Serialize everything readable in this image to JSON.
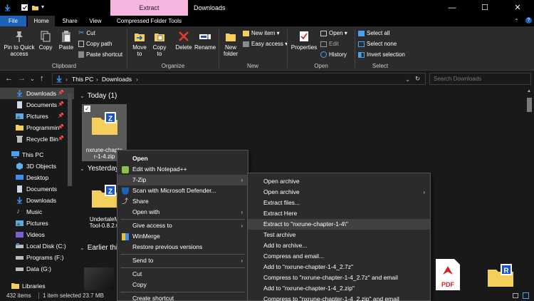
{
  "window": {
    "context_tab": "Extract",
    "title": "Downloads",
    "minimize": "—",
    "maximize": "☐",
    "close": "✕"
  },
  "ribbon_tabs": [
    "File",
    "Home",
    "Share",
    "View",
    "Compressed Folder Tools"
  ],
  "ribbon": {
    "clipboard": {
      "group": "Clipboard",
      "pin": "Pin to Quick access",
      "copy": "Copy",
      "paste": "Paste",
      "cut": "Cut",
      "copy_path": "Copy path",
      "paste_shortcut": "Paste shortcut"
    },
    "organize": {
      "group": "Organize",
      "move_to": "Move to",
      "copy_to": "Copy to",
      "delete": "Delete",
      "rename": "Rename"
    },
    "new": {
      "group": "New",
      "new_folder": "New folder",
      "new_item": "New item ▾",
      "easy_access": "Easy access ▾"
    },
    "open": {
      "group": "Open",
      "properties": "Properties",
      "open": "Open ▾",
      "edit": "Edit",
      "history": "History"
    },
    "select": {
      "group": "Select",
      "select_all": "Select all",
      "select_none": "Select none",
      "invert": "Invert selection"
    }
  },
  "address": {
    "crumbs": [
      "This PC",
      "Downloads"
    ],
    "search_placeholder": "Search Downloads"
  },
  "sidebar": {
    "items": [
      {
        "label": "Downloads",
        "pin": "📌"
      },
      {
        "label": "Documents",
        "pin": "📌"
      },
      {
        "label": "Pictures",
        "pin": "📌"
      },
      {
        "label": "Programmin",
        "pin": "📌"
      },
      {
        "label": "Recycle Bin",
        "pin": "📌"
      },
      {
        "label": "This PC",
        "pin": ""
      },
      {
        "label": "3D Objects",
        "pin": ""
      },
      {
        "label": "Desktop",
        "pin": ""
      },
      {
        "label": "Documents",
        "pin": ""
      },
      {
        "label": "Downloads",
        "pin": ""
      },
      {
        "label": "Music",
        "pin": ""
      },
      {
        "label": "Pictures",
        "pin": ""
      },
      {
        "label": "Videos",
        "pin": ""
      },
      {
        "label": "Local Disk (C:)",
        "pin": ""
      },
      {
        "label": "Programs (F:)",
        "pin": ""
      },
      {
        "label": "Data (G:)",
        "pin": ""
      },
      {
        "label": "Libraries",
        "pin": ""
      }
    ]
  },
  "content": {
    "groups": [
      "Today (1)",
      "Yesterday",
      "Earlier thi"
    ],
    "files": {
      "selected_line1": "nxrune-chapte",
      "selected_line2": "r-1-4.zip",
      "yesterday_line1": "UndertaleM",
      "yesterday_line2": "Tool-0.8.2.0"
    },
    "icon_letters": {
      "zip": "Z",
      "rar": "R",
      "pdf": "PDF"
    }
  },
  "status": {
    "items": "432 items",
    "selected": "1 item selected  23.7 MB"
  },
  "context_menu": [
    {
      "label": "Open",
      "bold": true
    },
    {
      "label": "Edit with Notepad++"
    },
    {
      "label": "7-Zip",
      "submenu": true
    },
    {
      "label": "Scan with Microsoft Defender..."
    },
    {
      "label": "Share"
    },
    {
      "label": "Open with",
      "submenu": true
    },
    {
      "label": "Give access to",
      "submenu": true
    },
    {
      "label": "WinMerge"
    },
    {
      "label": "Restore previous versions"
    },
    {
      "label": "Send to",
      "submenu": true
    },
    {
      "label": "Cut"
    },
    {
      "label": "Copy"
    },
    {
      "label": "Create shortcut"
    }
  ],
  "zip_submenu": [
    {
      "label": "Open archive"
    },
    {
      "label": "Open archive",
      "submenu": true
    },
    {
      "label": "Extract files..."
    },
    {
      "label": "Extract Here"
    },
    {
      "label": "Extract to \"nxrune-chapter-1-4\\\""
    },
    {
      "label": "Test archive"
    },
    {
      "label": "Add to archive..."
    },
    {
      "label": "Compress and email..."
    },
    {
      "label": "Add to \"nxrune-chapter-1-4_2.7z\""
    },
    {
      "label": "Compress to \"nxrune-chapter-1-4_2.7z\" and email"
    },
    {
      "label": "Add to \"nxrune-chapter-1-4_2.zip\""
    },
    {
      "label": "Compress to \"nxrune-chapter-1-4_2.zip\" and email"
    }
  ],
  "colors": {
    "accent": "#1b63b8",
    "context_tab": "#f4b6de",
    "folder": "#f4cf5c",
    "zip_badge": "#1a55c8",
    "pdf_red": "#d1232a"
  }
}
